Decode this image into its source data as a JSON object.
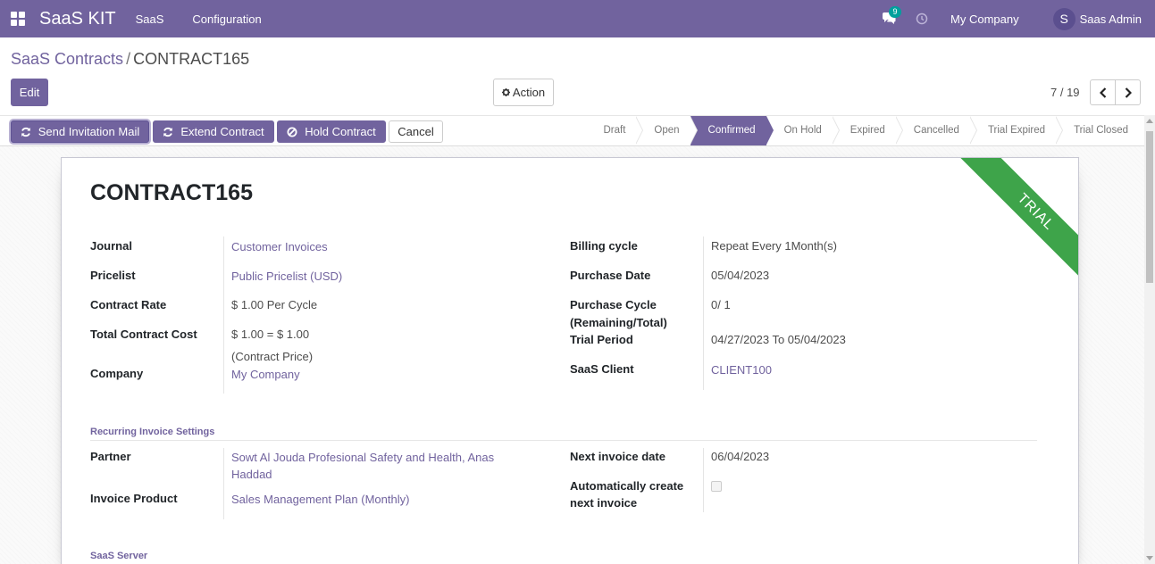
{
  "navbar": {
    "brand": "SaaS KIT",
    "menus": [
      "SaaS",
      "Configuration"
    ],
    "chat_badge": "9",
    "company": "My Company",
    "avatar_letter": "S",
    "user": "Saas Admin"
  },
  "breadcrumb": {
    "parent": "SaaS Contracts",
    "separator": "/",
    "current": "CONTRACT165"
  },
  "controls": {
    "edit_label": "Edit",
    "action_label": "Action",
    "pager": "7 / 19"
  },
  "statusbar": {
    "buttons": {
      "send_invitation": "Send Invitation Mail",
      "extend_contract": "Extend Contract",
      "hold_contract": "Hold Contract",
      "cancel": "Cancel"
    },
    "stages": [
      "Draft",
      "Open",
      "Confirmed",
      "On Hold",
      "Expired",
      "Cancelled",
      "Trial Expired",
      "Trial Closed"
    ],
    "active_stage": "Confirmed"
  },
  "form": {
    "title": "CONTRACT165",
    "ribbon": "TRIAL",
    "left": {
      "journal_label": "Journal",
      "journal_value": "Customer Invoices",
      "pricelist_label": "Pricelist",
      "pricelist_value": "Public Pricelist (USD)",
      "contract_rate_label": "Contract Rate",
      "contract_rate_value": "$ 1.00 Per Cycle",
      "total_cost_label": "Total Contract Cost",
      "total_cost_value_1": "$ 1.00 = $ 1.00",
      "total_cost_value_2": "(Contract Price)",
      "company_label": "Company",
      "company_value": "My Company"
    },
    "right": {
      "billing_cycle_label": "Billing cycle",
      "billing_cycle_value": "Repeat Every 1Month(s)",
      "purchase_date_label": "Purchase Date",
      "purchase_date_value": "05/04/2023",
      "purchase_cycle_label_1": "Purchase Cycle",
      "purchase_cycle_label_2": "(Remaining/Total)",
      "purchase_cycle_value": "0/ 1",
      "trial_period_label": "Trial Period",
      "trial_period_value": "04/27/2023 To 05/04/2023",
      "saas_client_label": "SaaS Client",
      "saas_client_value": "CLIENT100"
    },
    "recurring": {
      "section_title": "Recurring Invoice Settings",
      "partner_label": "Partner",
      "partner_value_1": "Sowt Al Jouda Profesional Safety and Health, Anas",
      "partner_value_2": "Haddad",
      "invoice_product_label": "Invoice Product",
      "invoice_product_value": "Sales Management Plan (Monthly)",
      "next_invoice_label": "Next invoice date",
      "next_invoice_value": "06/04/2023",
      "auto_create_label_1": "Automatically create",
      "auto_create_label_2": "next invoice",
      "auto_create_checked": false
    },
    "server_section_title": "SaaS Server"
  }
}
